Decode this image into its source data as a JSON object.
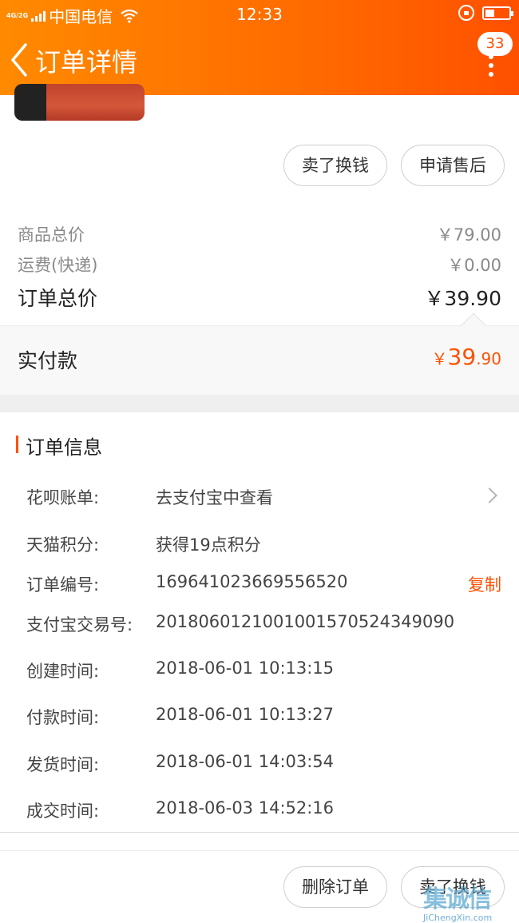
{
  "status_bar": {
    "network_tag": "4G/2G",
    "carrier": "中国电信",
    "time": "12:33",
    "battery_level": 0.4
  },
  "nav": {
    "title": "订单详情",
    "badge_count": "33"
  },
  "actions_top": {
    "sell_label": "卖了换钱",
    "after_sale_label": "申请售后"
  },
  "price": {
    "goods_total_label": "商品总价",
    "goods_total_value": "￥79.00",
    "shipping_label": "运费(快递)",
    "shipping_value": "￥0.00",
    "order_total_label": "订单总价",
    "order_total_value": "￥39.90",
    "paid_label": "实付款",
    "paid_currency": "￥",
    "paid_int": "39",
    "paid_dec": ".90"
  },
  "order_info": {
    "section_title": "订单信息",
    "huabei_label": "花呗账单:",
    "huabei_value": "去支付宝中查看",
    "points_label": "天猫积分:",
    "points_value": "获得19点积分",
    "order_no_label": "订单编号:",
    "order_no_value": "169641023669556520",
    "copy_label": "复制",
    "alipay_no_label": "支付宝交易号:",
    "alipay_no_value": "2018060121001001570524349090",
    "created_label": "创建时间:",
    "created_value": "2018-06-01 10:13:15",
    "paid_time_label": "付款时间:",
    "paid_time_value": "2018-06-01 10:13:27",
    "shipped_label": "发货时间:",
    "shipped_value": "2018-06-01 14:03:54",
    "deal_label": "成交时间:",
    "deal_value": "2018-06-03 14:52:16"
  },
  "footer": {
    "delete_label": "删除订单",
    "sell_label": "卖了换钱"
  },
  "watermark": {
    "main": "集诚信",
    "sub": "JiChengXin.com"
  },
  "colors": {
    "accent": "#ff5000",
    "header_start": "#ff8a00"
  }
}
